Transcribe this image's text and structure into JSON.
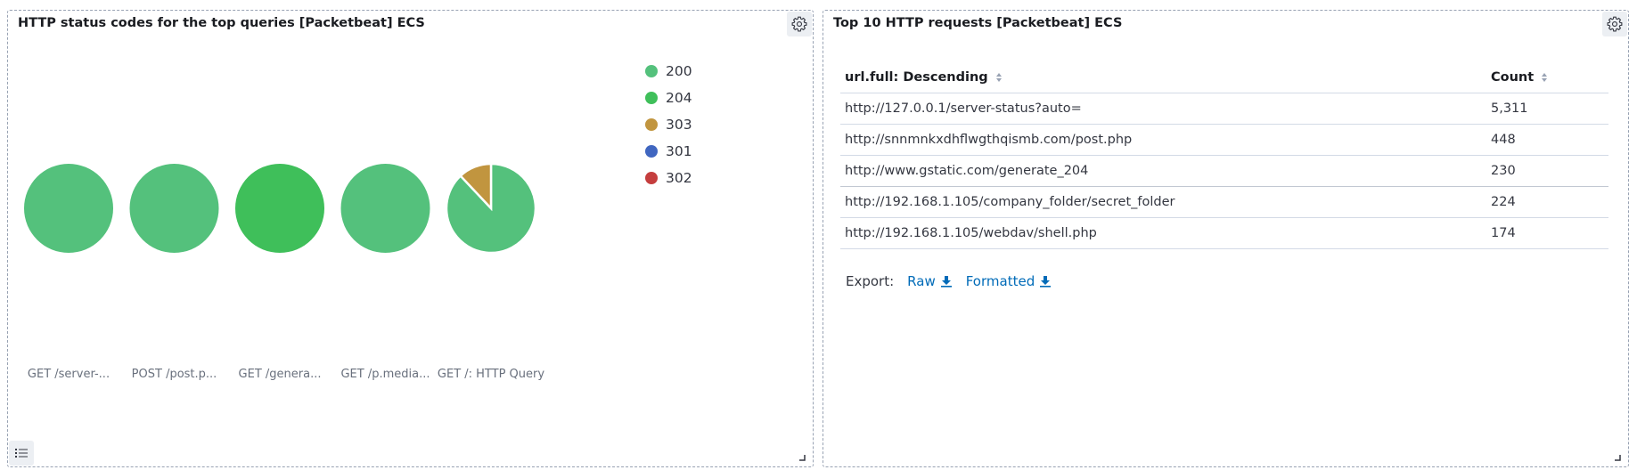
{
  "left_panel": {
    "title": "HTTP status codes for the top queries [Packetbeat] ECS",
    "settings_icon": "gear-icon",
    "legend_toggle_icon": "list-icon"
  },
  "right_panel": {
    "title": "Top 10 HTTP requests [Packetbeat] ECS",
    "settings_icon": "gear-icon",
    "table": {
      "columns": [
        "url.full: Descending",
        "Count"
      ],
      "rows": [
        [
          "http://127.0.0.1/server-status?auto=",
          "5,311"
        ],
        [
          "http://snnmnkxdhflwgthqismb.com/post.php",
          "448"
        ],
        [
          "http://www.gstatic.com/generate_204",
          "230"
        ],
        [
          "http://192.168.1.105/company_folder/secret_folder",
          "224"
        ],
        [
          "http://192.168.1.105/webdav/shell.php",
          "174"
        ]
      ]
    },
    "export": {
      "label": "Export:",
      "raw": "Raw",
      "formatted": "Formatted",
      "icon": "download-icon"
    }
  },
  "chart_data": {
    "type": "pie",
    "legend": {
      "position": "top-right",
      "entries": [
        {
          "label": "200",
          "color": "#54c17c"
        },
        {
          "label": "204",
          "color": "#3fbf5a"
        },
        {
          "label": "303",
          "color": "#c1953f"
        },
        {
          "label": "301",
          "color": "#4066c0"
        },
        {
          "label": "302",
          "color": "#c53e3e"
        }
      ]
    },
    "pies": [
      {
        "label": "GET /server-...",
        "slices": [
          {
            "status": "200",
            "value": 100
          }
        ]
      },
      {
        "label": "POST /post.p...",
        "slices": [
          {
            "status": "200",
            "value": 100
          }
        ]
      },
      {
        "label": "GET /genera...",
        "slices": [
          {
            "status": "204",
            "value": 100
          }
        ]
      },
      {
        "label": "GET /p.media...",
        "slices": [
          {
            "status": "200",
            "value": 100
          }
        ]
      },
      {
        "label": "GET /: HTTP Query",
        "slices": [
          {
            "status": "200",
            "value": 88
          },
          {
            "status": "303",
            "value": 12
          }
        ]
      }
    ]
  }
}
